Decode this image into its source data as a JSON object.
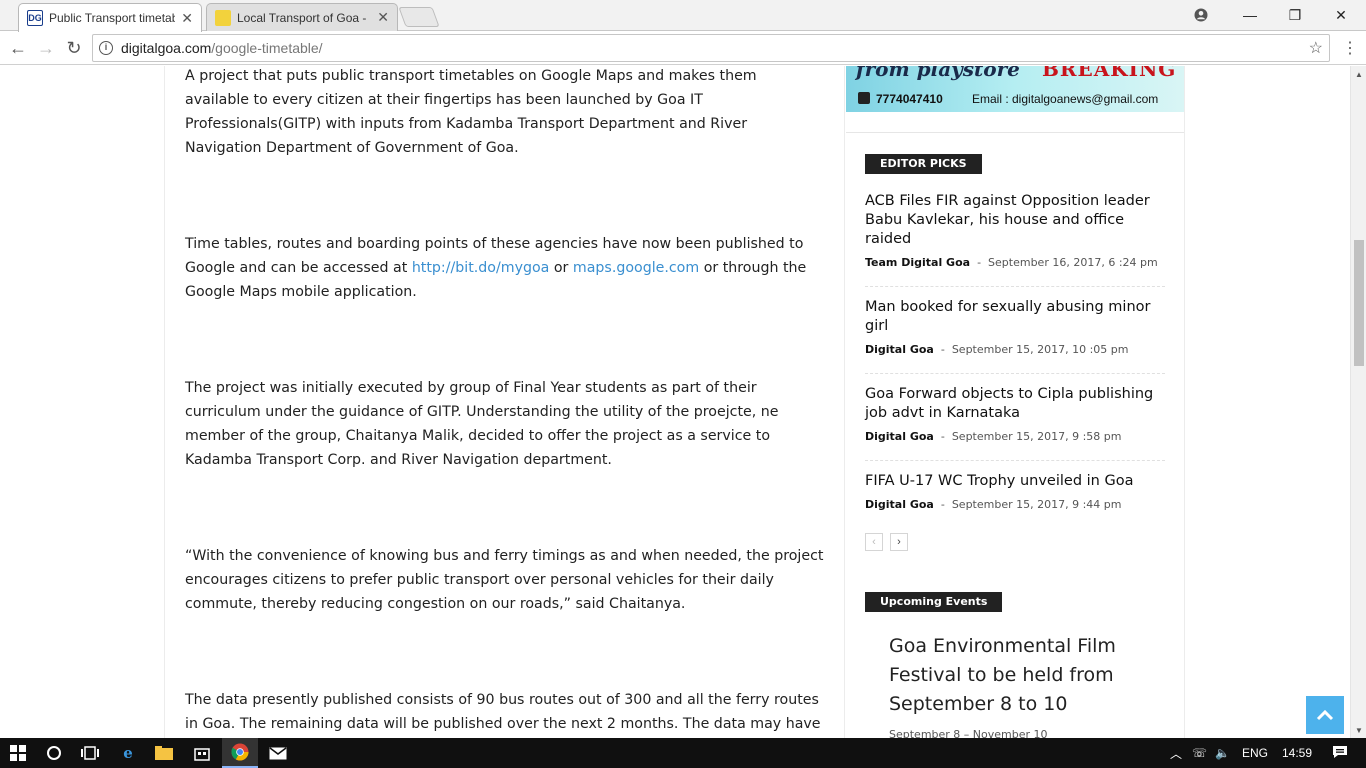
{
  "browser": {
    "tabs": [
      {
        "title": "Public Transport timetabl",
        "favicon_color": "#1a3e8c",
        "active": true
      },
      {
        "title": "Local Transport of Goa - ",
        "favicon_color": "#f2d23c",
        "active": false
      }
    ],
    "url_host": "digitalgoa.com",
    "url_path": "/google-timetable/"
  },
  "article": {
    "p1": "A project that puts public transport timetables on Google Maps and makes them available to every citizen at their fingertips has been launched by Goa IT Professionals(GITP)  with inputs from Kadamba Transport Department and River Navigation Department of Government of Goa.",
    "p2_before": "Time tables, routes and boarding points of these agencies have now been published to Google and can be accessed at ",
    "p2_link1": "http://bit.do/mygoa",
    "p2_mid": " or ",
    "p2_link2": "maps.google.com",
    "p2_after": " or through the Google Maps mobile application.",
    "p3": "The project was initially executed by  group of Final Year students as part of their curriculum under the guidance of GITP. Understanding the utility of the proejcte, ne member of the group,   Chaitanya Malik, decided to offer the project as a service to Kadamba Transport Corp. and River Navigation department.",
    "p4": "“With the convenience of knowing bus and ferry timings as and when needed, the project encourages citizens to prefer public transport over personal vehicles for their daily commute, thereby reducing congestion on our roads,” said Chaitanya.",
    "p5": "The data presently published consists of 90 bus routes out of 300 and all the ferry routes in Goa. The remaining data will be published over the next 2 months. The data may have"
  },
  "banner": {
    "top_left": "from playstore",
    "top_right": "BREAKING",
    "phone": "7774047410",
    "email": "Email : digitalgoanews@gmail.com"
  },
  "sidebar": {
    "editor_picks_label": "EDITOR PICKS",
    "picks": [
      {
        "title": "ACB Files FIR against Opposition leader Babu Kavlekar, his house and office raided",
        "author": "Team Digital Goa",
        "date": "September 16, 2017, 6 :24 pm"
      },
      {
        "title": "Man booked for sexually abusing minor girl",
        "author": "Digital Goa",
        "date": "September 15, 2017, 10 :05 pm"
      },
      {
        "title": "Goa Forward objects to Cipla publishing job advt in Karnataka",
        "author": "Digital Goa",
        "date": "September 15, 2017, 9 :58 pm"
      },
      {
        "title": "FIFA U-17 WC Trophy unveiled in Goa",
        "author": "Digital Goa",
        "date": "September 15, 2017, 9 :44 pm"
      }
    ],
    "meta_sep": "-",
    "pager_prev": "‹",
    "pager_next": "›",
    "events_label": "Upcoming Events",
    "event_title": "Goa Environmental Film Festival to be held from September 8 to 10",
    "event_date": "September 8 – November 10"
  },
  "taskbar": {
    "lang": "ENG",
    "time": "14:59"
  }
}
